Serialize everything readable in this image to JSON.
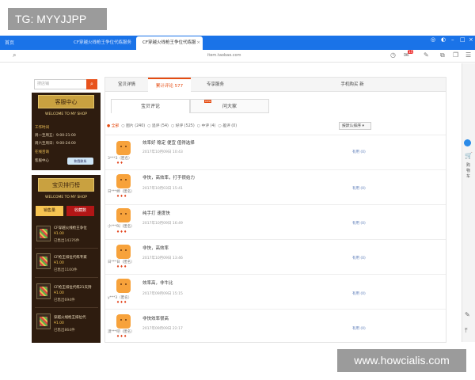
{
  "watermarks": {
    "top_left": "TG: MYYJJPP",
    "bottom_right": "www.howcialis.com"
  },
  "browser": {
    "home_label": "首页",
    "tabs": [
      {
        "label": "CF穿越火线枪王争位代练服务",
        "active": false
      },
      {
        "label": "CF穿越火线枪王争位代练服",
        "active": true
      }
    ],
    "url": "item.taobao.com",
    "badge": "15",
    "icons": [
      "history-icon",
      "mail-icon",
      "pen-icon",
      "external-icon",
      "copy-icon",
      "menu-icon"
    ]
  },
  "right_sidebar": {
    "text": "购物车"
  },
  "shop": {
    "search_placeholder": "搜店铺",
    "service": {
      "title": "客服中心",
      "welcome": "WELCOME TO MY SHOP",
      "hours_heading": "工作时间",
      "hours1": "周一至周五：9:00-21:00",
      "hours2": "周六至周日：9:00-24:00",
      "online_heading": "在线咨询",
      "online_label": "客服中心",
      "online_badge": "和我联系"
    },
    "ranking": {
      "title": "宝贝排行榜",
      "welcome": "WELCOME TO MY SHOP",
      "tab_sales": "销售量",
      "tab_fav": "收藏数",
      "items": [
        {
          "name": "CF穿越火线枪王争位",
          "price": "¥1.00",
          "sold": "已售出14376件"
        },
        {
          "name": "CF枪王排位代练专家",
          "price": "¥1.00",
          "sold": "已售出1100件"
        },
        {
          "name": "CF枪王排位代练21天持",
          "price": "¥1.00",
          "sold": "已售出694件"
        },
        {
          "name": "穿越火线枪王排位代",
          "price": "¥1.00",
          "sold": "已售出864件"
        }
      ]
    }
  },
  "main": {
    "tabs": [
      {
        "label": "宝贝详情"
      },
      {
        "label": "累计评论 577"
      },
      {
        "label": "专享服务"
      }
    ],
    "right_link": "手机购买 新",
    "subtabs": [
      {
        "label": "宝贝评论"
      },
      {
        "label": "问大家"
      }
    ],
    "new_mark": "new",
    "filters": {
      "all": "全部",
      "with_img": "图片 (240)",
      "append": "追评 (54)",
      "good": "好评 (525)",
      "mid": "中评 (4)",
      "bad": "差评 (0)"
    },
    "sort_label": "按默认排序",
    "reviews": [
      {
        "text": "效率好 稳定 便宜 值得选择",
        "date": "2017年10月09日 10:43",
        "user": "3***3（匿名）",
        "medals": "♦♦",
        "action": "有用 (0)"
      },
      {
        "text": "非快，高效率，打手很给力",
        "date": "2017年10月03日 15:41",
        "user": "日***婷（匿名）",
        "medals": "♦♦♦",
        "action": "有用 (0)"
      },
      {
        "text": "纯手打 速度快",
        "date": "2017年10月09日 16:49",
        "user": "小***叫（匿名）",
        "medals": "♦♦♦",
        "action": "有用 (0)"
      },
      {
        "text": "非快，高效率",
        "date": "2017年10月09日 13:46",
        "user": "日***日（匿名）",
        "medals": "♦♦♦",
        "action": "有用 (0)"
      },
      {
        "text": "效率高，非牛比",
        "date": "2017年09月09日 15:15",
        "user": "y***3（匿名）",
        "medals": "♦♦♦",
        "action": "有用 (0)"
      },
      {
        "text": "非快效率很高",
        "date": "2017年09月09日 22:17",
        "user": "漠***吧（匿名）",
        "medals": "♦♦♦",
        "action": "有用 (0)"
      }
    ]
  }
}
